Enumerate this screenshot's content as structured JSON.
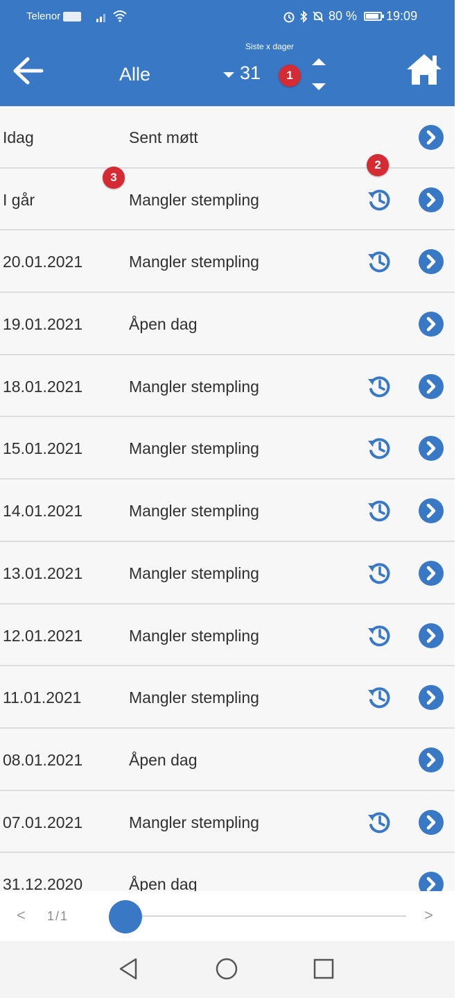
{
  "status_bar": {
    "carrier": "Telenor",
    "battery": "80 %",
    "time": "19:09"
  },
  "header": {
    "filter_label": "Alle",
    "days_caption": "Siste x dager",
    "days_value": "31"
  },
  "badges": [
    "1",
    "2",
    "3"
  ],
  "rows": [
    {
      "date": "Idag",
      "status": "Sent møtt",
      "history": false
    },
    {
      "date": "I går",
      "status": "Mangler stempling",
      "history": true
    },
    {
      "date": "20.01.2021",
      "status": "Mangler stempling",
      "history": true
    },
    {
      "date": "19.01.2021",
      "status": "Åpen dag",
      "history": false
    },
    {
      "date": "18.01.2021",
      "status": "Mangler stempling",
      "history": true
    },
    {
      "date": "15.01.2021",
      "status": "Mangler stempling",
      "history": true
    },
    {
      "date": "14.01.2021",
      "status": "Mangler stempling",
      "history": true
    },
    {
      "date": "13.01.2021",
      "status": "Mangler stempling",
      "history": true
    },
    {
      "date": "12.01.2021",
      "status": "Mangler stempling",
      "history": true
    },
    {
      "date": "11.01.2021",
      "status": "Mangler stempling",
      "history": true
    },
    {
      "date": "08.01.2021",
      "status": "Åpen dag",
      "history": false
    },
    {
      "date": "07.01.2021",
      "status": "Mangler stempling",
      "history": true
    },
    {
      "date": "31.12.2020",
      "status": "Åpen dag",
      "history": false
    }
  ],
  "pager": {
    "prev": "<",
    "pages": "1/1",
    "next": ">"
  },
  "icons": {
    "back": "arrow-left-icon",
    "home": "home-icon",
    "history": "history-icon",
    "go": "chevron-right-circle-icon"
  },
  "colors": {
    "primary": "#3878c4",
    "badge": "#d42b35",
    "row_bg": "#f7f7f7"
  }
}
